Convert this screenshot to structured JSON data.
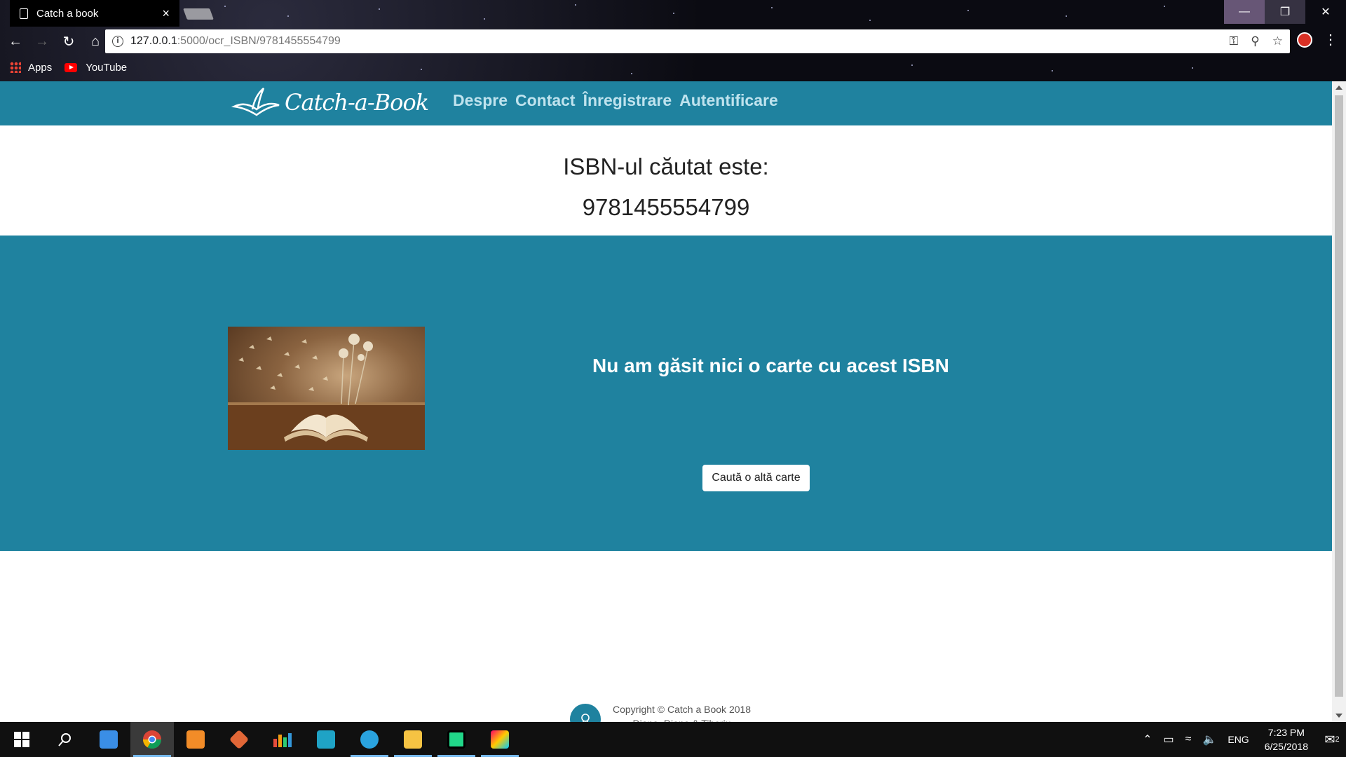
{
  "browser": {
    "tab_title": "Catch a book",
    "tab_close": "×",
    "url_host": "127.0.0.1",
    "url_path": ":5000/ocr_ISBN/9781455554799",
    "bookmarks": [
      {
        "label": "Apps",
        "icon": "apps-grid-icon"
      },
      {
        "label": "YouTube",
        "icon": "youtube-icon"
      }
    ]
  },
  "site": {
    "logo_text": "Catch-a-Book",
    "nav": [
      "Despre",
      "Contact",
      "Înregistrare",
      "Autentificare"
    ],
    "isbn_heading": "ISBN-ul căutat este:",
    "isbn_value": "9781455554799",
    "result_message": "Nu am găsit nici o carte cu acest ISBN",
    "search_again_label": "Caută o altă carte",
    "footer_line1": "Copyright © Catch a Book 2018",
    "footer_line2": "Diana, Diana & Tiberiu",
    "accent_color": "#1f829f"
  },
  "taskbar": {
    "time": "7:23 PM",
    "date": "6/25/2018",
    "language": "ENG",
    "notifications": "2",
    "apps": [
      "windows-start-icon",
      "search-icon",
      "this-pc-icon",
      "chrome-icon",
      "sublime-text-icon",
      "matlab-icon",
      "app-bars-icon",
      "instagram-icon",
      "telegram-icon",
      "file-explorer-icon",
      "pycharm-icon",
      "paint-icon"
    ]
  }
}
